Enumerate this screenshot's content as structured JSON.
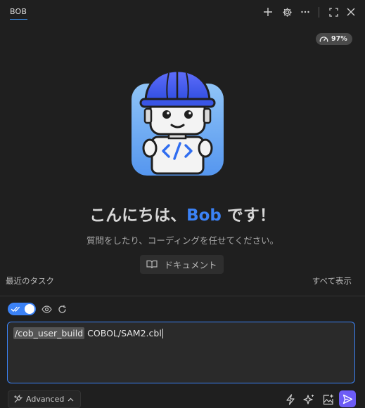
{
  "header": {
    "tab_label": "BOB",
    "icons": [
      "plus-icon",
      "gear-icon",
      "more-icon",
      "fullscreen-icon",
      "close-icon"
    ]
  },
  "usage_badge": {
    "text": "97%",
    "icon": "gauge-icon"
  },
  "welcome": {
    "greeting_prefix": "こんにちは、",
    "greeting_name": "Bob",
    "greeting_suffix": " です！",
    "subtitle": "質問をしたり、コーディングを任せてください。",
    "docs_button": "ドキュメント"
  },
  "tasks": {
    "recent_label": "最近のタスク",
    "show_all_label": "すべて表示"
  },
  "composer": {
    "command": "/cob_user_build",
    "text": " COBOL/SAM2.cbl",
    "mode_label": "Advanced"
  },
  "colors": {
    "accent": "#3b82f6",
    "send": "#6d5cf6",
    "background": "#1f1f1f"
  }
}
